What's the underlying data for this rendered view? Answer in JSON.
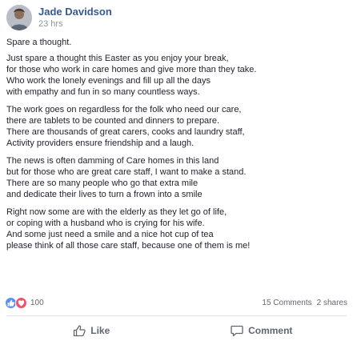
{
  "post": {
    "author": "Jade Davidson",
    "time": "23 hrs",
    "paragraphs": [
      "Spare a thought.",
      "Just spare a thought this Easter as you enjoy your break,\nfor those who work in care homes and give more than they take.\nWho work the lonely evenings and fill up all the days\nwith empathy and fun in so many countless ways.",
      "The work goes on regardless for the folk who need our care,\nthere are tablets to be counted and dinners to prepare.\nThere are thousands of great carers, cooks and laundry staff,\nActivity providers ensure friendship and a laugh.",
      "The news is often damming of Care homes in this land\nbut for those who are great care staff, I want to make a stand.\nThere are so many people who go that extra mile\nand dedicate their lives to turn a frown into a smile",
      "Right now some are with the elderly as they let go of life,\nor coping with a husband who is crying for his wife.\nAnd some just need a smile and a nice hot cup of tea\nplease think of all those care staff, because one of them is me!"
    ]
  },
  "reactions": {
    "count": "100",
    "comments": "15 Comments",
    "shares": "2 shares",
    "icons": [
      "like-icon",
      "love-icon"
    ]
  },
  "actions": {
    "like": "Like",
    "comment": "Comment"
  },
  "colors": {
    "author_link": "#365899",
    "like_blue": "#5890ff",
    "love_red": "#f25268",
    "muted": "#90949c"
  }
}
